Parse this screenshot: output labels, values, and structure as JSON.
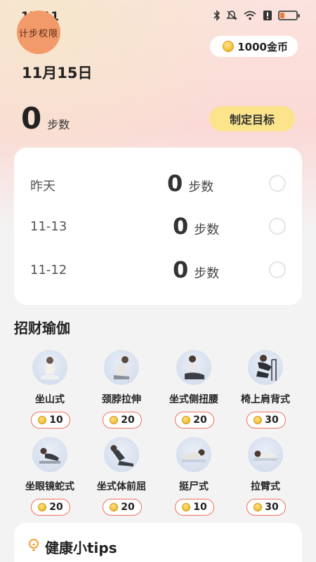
{
  "status_bar": {
    "time": "17:11",
    "icons": [
      "bluetooth-icon",
      "mute-icon",
      "wifi-icon",
      "alert-icon",
      "battery-icon"
    ]
  },
  "header": {
    "permission_badge": "计步权限",
    "coins": "1000金币",
    "date": "11月15日",
    "steps_today": "0",
    "steps_unit": "步数",
    "goal_button": "制定目标"
  },
  "history": [
    {
      "day": "昨天",
      "steps": "0",
      "unit": "步数"
    },
    {
      "day": "11-13",
      "steps": "0",
      "unit": "步数"
    },
    {
      "day": "11-12",
      "steps": "0",
      "unit": "步数"
    }
  ],
  "yoga": {
    "title": "招财瑜伽",
    "items": [
      {
        "name": "坐山式",
        "reward": "10"
      },
      {
        "name": "颈脖拉伸",
        "reward": "20"
      },
      {
        "name": "坐式侧扭腰",
        "reward": "20"
      },
      {
        "name": "椅上肩背式",
        "reward": "30"
      },
      {
        "name": "坐眼镜蛇式",
        "reward": "20"
      },
      {
        "name": "坐式体前屈",
        "reward": "20"
      },
      {
        "name": "挺尸式",
        "reward": "10"
      },
      {
        "name": "拉臂式",
        "reward": "30"
      }
    ]
  },
  "tips": {
    "title": "健康小tips"
  },
  "colors": {
    "accent_yellow": "#fbe48c",
    "badge_orange": "#f39a6a",
    "reward_border": "#f07060",
    "coin_gold": "#f5c23a"
  }
}
